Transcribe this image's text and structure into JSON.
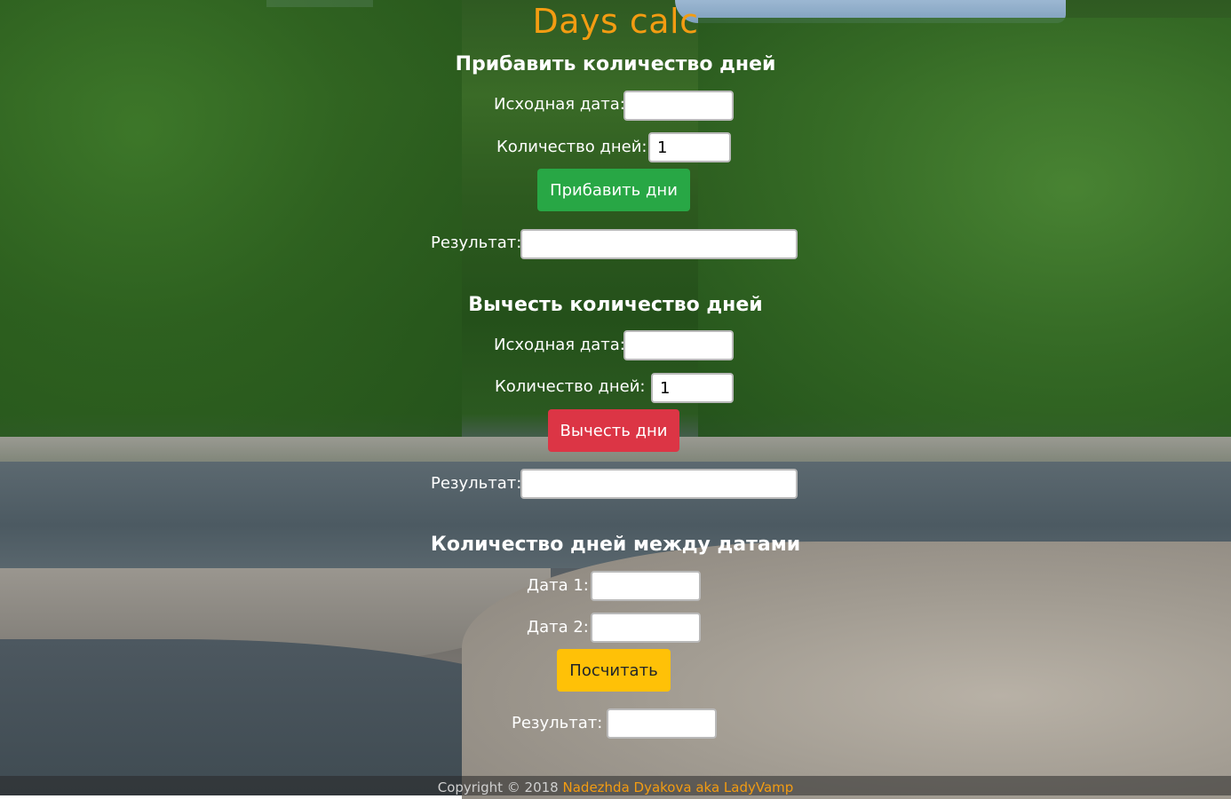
{
  "app_title": "Days calc",
  "add_section": {
    "heading": "Прибавить количество дней",
    "start_date_label": "Исходная дата:",
    "start_date_value": "",
    "days_label": "Количество дней:",
    "days_value": "1",
    "button_label": "Прибавить дни",
    "result_label": "Результат:",
    "result_value": ""
  },
  "subtract_section": {
    "heading": "Вычесть количество дней",
    "start_date_label": "Исходная дата:",
    "start_date_value": "",
    "days_label": "Количество дней:",
    "days_value": "1",
    "button_label": "Вычесть дни",
    "result_label": "Результат:",
    "result_value": ""
  },
  "between_section": {
    "heading": "Количество дней между датами",
    "date1_label": "Дата 1:",
    "date1_value": "",
    "date2_label": "Дата 2:",
    "date2_value": "",
    "button_label": "Посчитать",
    "result_label": "Результат:",
    "result_value": ""
  },
  "footer": {
    "copyright": "Copyright © 2018",
    "author": "Nadezhda Dyakova aka LadyVamp"
  },
  "colors": {
    "title": "#f39c12",
    "add_button": "#28a745",
    "subtract_button": "#dc3545",
    "count_button": "#ffc107"
  }
}
